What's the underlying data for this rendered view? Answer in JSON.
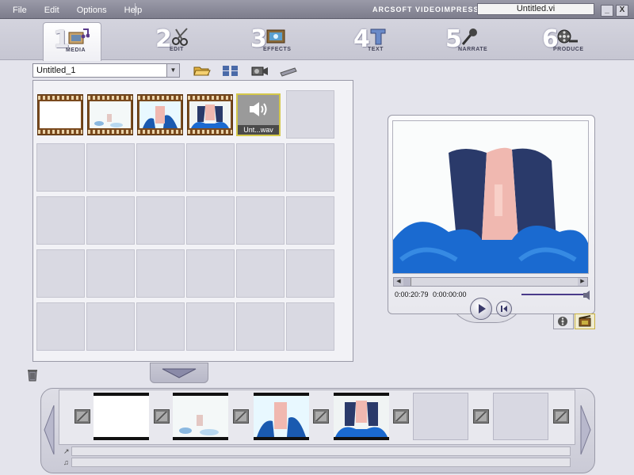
{
  "menu": {
    "items": [
      "File",
      "Edit",
      "Options",
      "Help"
    ]
  },
  "app_title": "ARCSOFT VIDEOIMPRESSION",
  "file_title": "Untitled.vi",
  "window_buttons": {
    "minimize": "_",
    "close": "X"
  },
  "tabs": [
    {
      "num": "1",
      "label": "MEDIA",
      "icon": "media-icon",
      "active": true
    },
    {
      "num": "2",
      "label": "EDIT",
      "icon": "scissors-icon",
      "active": false
    },
    {
      "num": "3",
      "label": "EFFECTS",
      "icon": "effects-icon",
      "active": false
    },
    {
      "num": "4",
      "label": "TEXT",
      "icon": "text-icon",
      "active": false
    },
    {
      "num": "5",
      "label": "NARRATE",
      "icon": "microphone-icon",
      "active": false
    },
    {
      "num": "6",
      "label": "PRODUCE",
      "icon": "film-reel-icon",
      "active": false
    }
  ],
  "album": {
    "selected": "Untitled_1"
  },
  "media_toolbar": [
    "open-folder-icon",
    "scan-icon",
    "camera-icon",
    "tape-icon"
  ],
  "media_items": [
    {
      "type": "video",
      "frame": "white"
    },
    {
      "type": "video",
      "frame": "partial"
    },
    {
      "type": "video",
      "frame": "blue-figure"
    },
    {
      "type": "video",
      "frame": "figure"
    },
    {
      "type": "audio",
      "label": "Unt...wav"
    }
  ],
  "preview": {
    "time_current": "0:00:20:79",
    "time_start": "0:00:00:00"
  },
  "storyboard": {
    "clips": [
      "white",
      "partial",
      "blue-figure",
      "figure",
      "empty",
      "empty"
    ]
  },
  "colors": {
    "accent": "#d4c84a",
    "frame": "#9a9aa8",
    "panel": "#f2f2f6"
  }
}
